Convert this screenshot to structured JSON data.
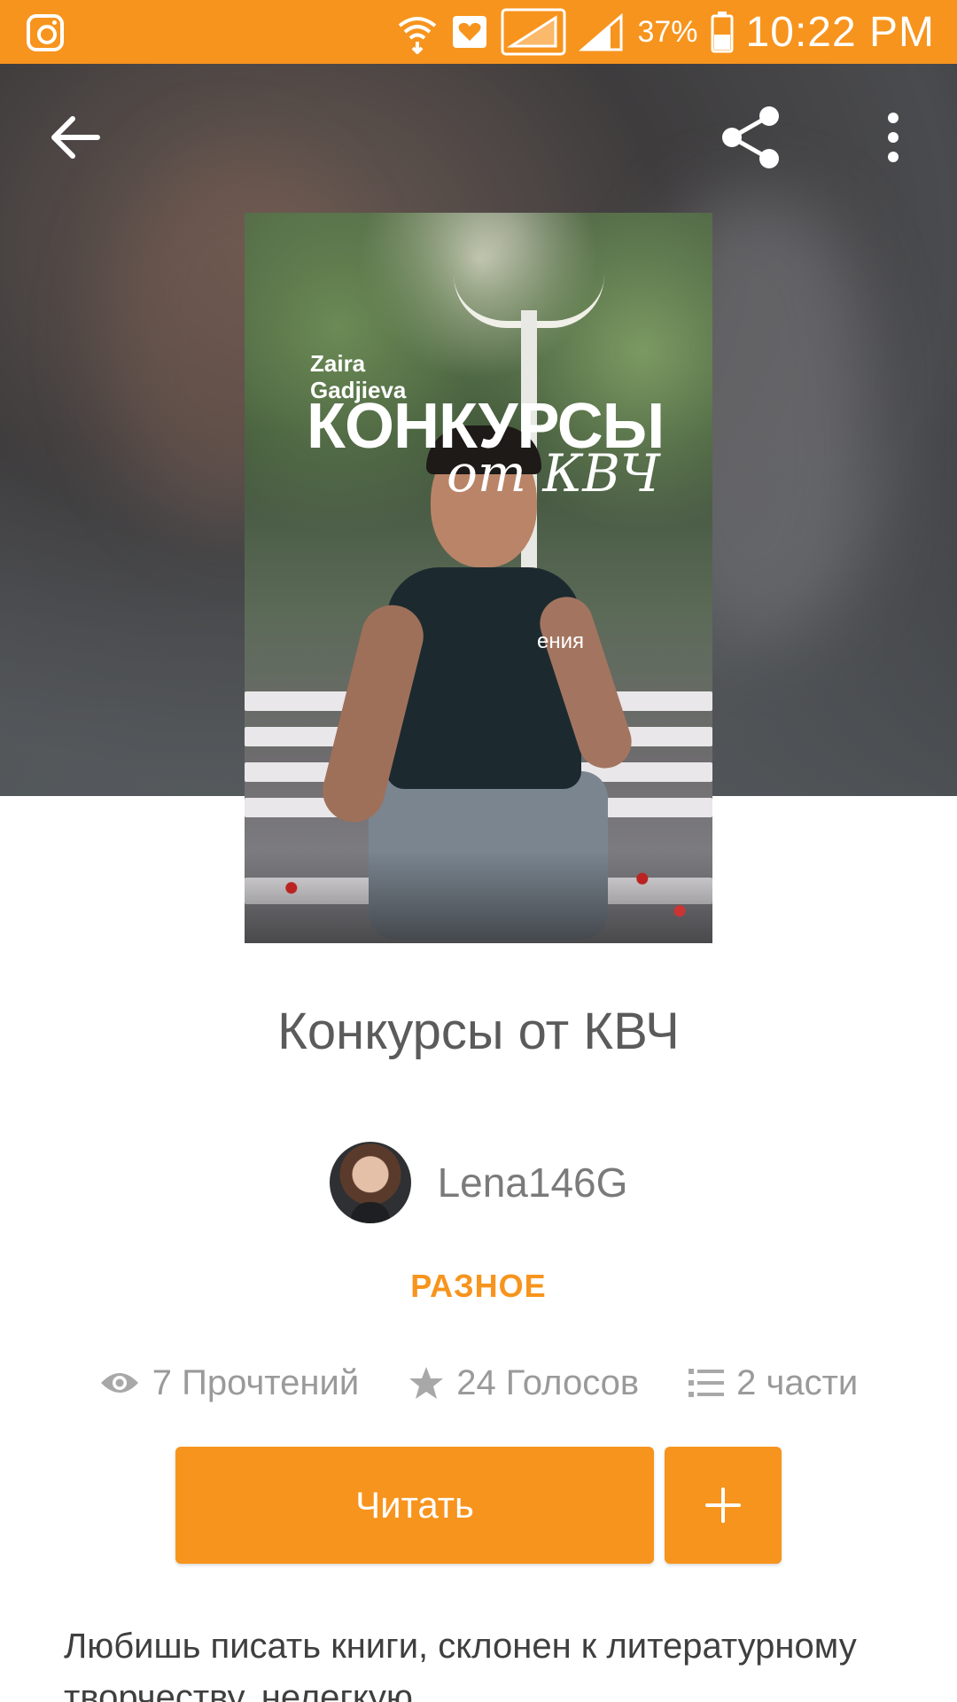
{
  "status_bar": {
    "battery": "37%",
    "time": "10:22 PM",
    "icons": [
      "instagram-icon",
      "wifi-icon",
      "health-icon",
      "signal-icon",
      "signal-icon",
      "battery-icon"
    ]
  },
  "toolbar": {
    "icons": [
      "back-arrow-icon",
      "share-icon",
      "more-vert-icon"
    ]
  },
  "cover": {
    "author": "Zaira\nGadjieva",
    "title": "КОНКУРСЫ",
    "script": "от КВЧ",
    "subtitle": "ения"
  },
  "book": {
    "title": "Конкурсы от КВЧ",
    "author": "Lena146G",
    "genre": "РАЗНОЕ",
    "stats": {
      "reads": "7 Прочтений",
      "votes": "24 Голосов",
      "parts": "2 части"
    },
    "description": "Любишь писать книги, склонен к литературному творчеству, нелегкую"
  },
  "actions": {
    "read_label": "Читать",
    "add_icon": "plus-icon"
  },
  "colors": {
    "accent": "#f7941d",
    "title_text": "#5b5b5b",
    "stat_text": "#9a9a9a"
  }
}
